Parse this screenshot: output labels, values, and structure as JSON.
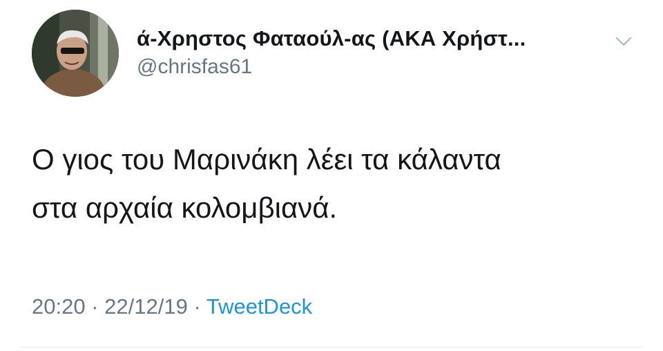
{
  "tweet": {
    "display_name": "ά-Χρηστος Φαταούλ-ας (ΑΚΑ Χρήστ...",
    "handle": "@chrisfas61",
    "text_lines": [
      "Ο γιος του Μαρινάκη λέει τα κάλαντα",
      "στα αρχαία κολομβιανά."
    ],
    "time": "20:20",
    "date": "22/12/19",
    "separator": "·",
    "source": "TweetDeck"
  },
  "icons": {
    "avatar": "profile-photo",
    "caret": "chevron-down-icon"
  },
  "colors": {
    "text": "#14171a",
    "secondary": "#657786",
    "link": "#1b95e0",
    "divider": "#e1e8ed"
  }
}
